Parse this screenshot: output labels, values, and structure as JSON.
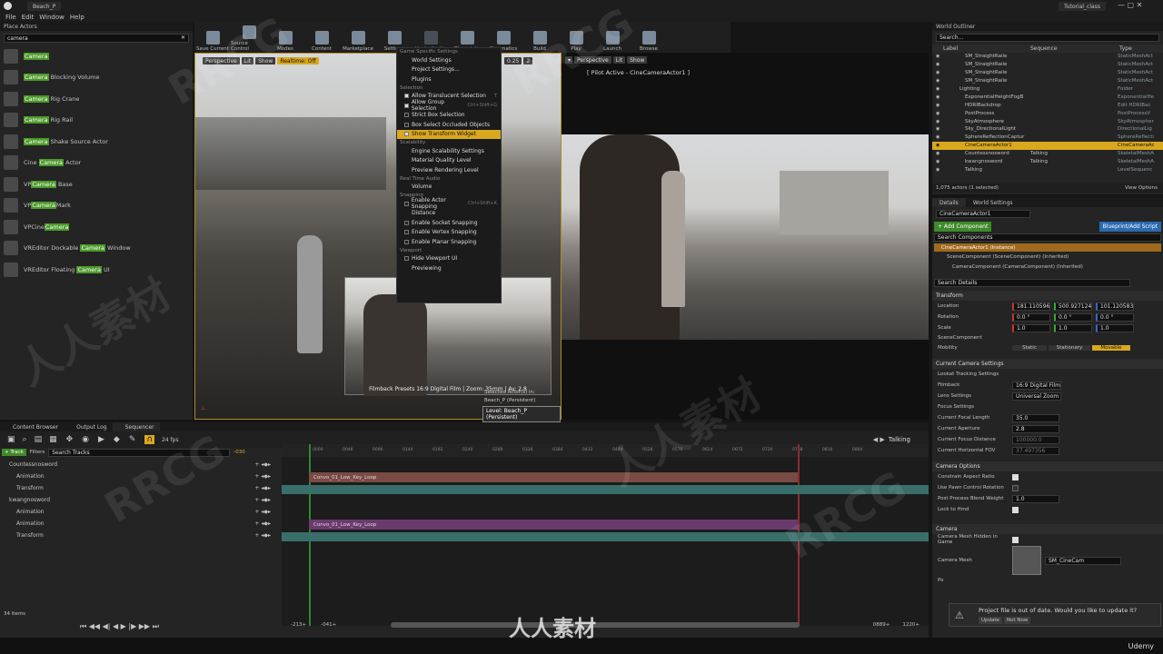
{
  "window": {
    "tab": "Beach_P",
    "project": "Tutorial_class"
  },
  "menu": [
    "File",
    "Edit",
    "Window",
    "Help"
  ],
  "place_actors": {
    "title": "Place Actors",
    "search": "camera",
    "items": [
      {
        "pre": "",
        "hl": "Camera",
        "post": ""
      },
      {
        "pre": "",
        "hl": "Camera",
        "post": " Blocking Volume"
      },
      {
        "pre": "",
        "hl": "Camera",
        "post": " Rig Crane"
      },
      {
        "pre": "",
        "hl": "Camera",
        "post": " Rig Rail"
      },
      {
        "pre": "",
        "hl": "Camera",
        "post": " Shake Source Actor"
      },
      {
        "pre": "Cine ",
        "hl": "Camera",
        "post": " Actor"
      },
      {
        "pre": "VP",
        "hl": "Camera",
        "post": " Base"
      },
      {
        "pre": "VP",
        "hl": "Camera",
        "post": "Mark"
      },
      {
        "pre": "VPCine",
        "hl": "Camera",
        "post": ""
      },
      {
        "pre": "VREditor Dockable ",
        "hl": "Camera",
        "post": " Window"
      },
      {
        "pre": "VREditor Floating ",
        "hl": "Camera",
        "post": " UI"
      }
    ]
  },
  "toolbar": [
    "Save Current",
    "Source Control",
    "Modes",
    "Content",
    "Marketplace",
    "Settings",
    "Media Profile",
    "Blueprints",
    "Cinematics",
    "Build",
    "Play",
    "Launch",
    "Browse"
  ],
  "viewport_left": {
    "perspective": "Perspective",
    "lit": "Lit",
    "show": "Show",
    "realtime": "Realtime: Off",
    "fov": "0.25",
    "num": "2",
    "film_info": "Filmback Presets 16:9 Digital Film | Zoom: 35mm | Av: 2.8",
    "selected": "Selected Actor(s) in:",
    "level_name": "Beach_P (Persistent)",
    "level_label": "Level:  Beach_P (Persistent)"
  },
  "settings_menu": {
    "sections": [
      {
        "title": "Game Specific Settings",
        "items": [
          {
            "label": "World Settings",
            "check": null,
            "sc": ""
          },
          {
            "label": "Project Settings...",
            "check": null,
            "sc": ""
          },
          {
            "label": "Plugins",
            "check": null,
            "sc": ""
          }
        ]
      },
      {
        "title": "Selection",
        "items": [
          {
            "label": "Allow Translucent Selection",
            "check": true,
            "sc": "T"
          },
          {
            "label": "Allow Group Selection",
            "check": true,
            "sc": "Ctrl+Shift+G"
          },
          {
            "label": "Strict Box Selection",
            "check": false,
            "sc": ""
          },
          {
            "label": "Box Select Occluded Objects",
            "check": false,
            "sc": ""
          },
          {
            "label": "Show Transform Widget",
            "check": true,
            "sc": ""
          }
        ]
      },
      {
        "title": "Scalability",
        "items": [
          {
            "label": "Engine Scalability Settings",
            "check": null,
            "sc": ""
          },
          {
            "label": "Material Quality Level",
            "check": null,
            "sc": ""
          },
          {
            "label": "Preview Rendering Level",
            "check": null,
            "sc": ""
          }
        ]
      },
      {
        "title": "Real Time Audio",
        "items": [
          {
            "label": "Volume",
            "check": null,
            "sc": ""
          }
        ]
      },
      {
        "title": "Snapping",
        "items": [
          {
            "label": "Enable Actor Snapping",
            "check": false,
            "sc": "Ctrl+Shift+K"
          },
          {
            "label": "Distance",
            "check": null,
            "sc": ""
          },
          {
            "label": "Enable Socket Snapping",
            "check": false,
            "sc": ""
          },
          {
            "label": "Enable Vertex Snapping",
            "check": false,
            "sc": ""
          },
          {
            "label": "Enable Planar Snapping",
            "check": false,
            "sc": ""
          }
        ]
      },
      {
        "title": "Viewport",
        "items": [
          {
            "label": "Hide Viewport UI",
            "check": false,
            "sc": ""
          },
          {
            "label": "Previewing",
            "check": null,
            "sc": ""
          }
        ]
      }
    ]
  },
  "viewport_right": {
    "perspective": "Perspective",
    "lit": "Lit",
    "show": "Show",
    "pilot": "[ Pilot Active - CineCameraActor1 ]"
  },
  "outliner": {
    "title": "World Outliner",
    "search": "Search...",
    "cols": [
      "Label",
      "Sequence",
      "Type"
    ],
    "rows": [
      {
        "label": "SM_StraightRaile",
        "seq": "",
        "type": "StaticMeshAct"
      },
      {
        "label": "SM_StraightRaile",
        "seq": "",
        "type": "StaticMeshAct"
      },
      {
        "label": "SM_StraightRaile",
        "seq": "",
        "type": "StaticMeshAct"
      },
      {
        "label": "SM_StraightRaile",
        "seq": "",
        "type": "StaticMeshAct"
      },
      {
        "label": "Lighting",
        "seq": "",
        "type": "Folder"
      },
      {
        "label": "ExponentialHeightFogB",
        "seq": "",
        "type": "ExponentialHe"
      },
      {
        "label": "HDRIBackdrop",
        "seq": "",
        "type": "Edit HDRIBac"
      },
      {
        "label": "PostProcess",
        "seq": "",
        "type": "PostProcessV"
      },
      {
        "label": "SkyAtmosphere",
        "seq": "",
        "type": "SkyAtmospher"
      },
      {
        "label": "Sky_DirectionalLight",
        "seq": "",
        "type": "DirectionalLig"
      },
      {
        "label": "SphereReflectionCaptur",
        "seq": "",
        "type": "SphereReflecti"
      },
      {
        "label": "CineCameraActor1",
        "seq": "",
        "type": "CineCameraAc"
      },
      {
        "label": "Countessnosword",
        "seq": "Talking",
        "type": "SkeletalMeshA"
      },
      {
        "label": "kwangnosword",
        "seq": "Talking",
        "type": "SkeletalMeshA"
      },
      {
        "label": "Talking",
        "seq": "",
        "type": "LevelSequenc"
      }
    ],
    "count": "1,075 actors (1 selected)",
    "view_options": "View Options"
  },
  "details": {
    "tab1": "Details",
    "tab2": "World Settings",
    "name": "CineCameraActor1",
    "add": "+ Add Component",
    "bp": "Blueprint/Add Script",
    "search_comp": "Search Components",
    "instance": "CineCameraActor1 (Instance)",
    "comp1": "SceneComponent (SceneComponent) (Inherited)",
    "comp2": "CameraComponent (CameraComponent) (Inherited)",
    "search_details": "Search Details",
    "transform": "Transform",
    "location": "Location",
    "loc": [
      "181.110596",
      "500.927124",
      "101.120583"
    ],
    "rotation": "Rotation",
    "rot": [
      "0.0 °",
      "0.0 °",
      "0.0 °"
    ],
    "scale": "Scale",
    "scl": [
      "1.0",
      "1.0",
      "1.0"
    ],
    "scene_comp": "SceneComponent",
    "mobility": "Mobility",
    "mob": [
      "Static",
      "Stationary",
      "Movable"
    ],
    "ccs": "Current Camera Settings",
    "lookat": "Lookat Tracking Settings",
    "filmback": "Filmback",
    "filmback_v": "16:9 Digital Film",
    "lens": "Lens Settings",
    "lens_v": "Universal Zoom",
    "focus": "Focus Settings",
    "cfl": "Current Focal Length",
    "cfl_v": "35.0",
    "ca": "Current Aperture",
    "ca_v": "2.8",
    "cfd": "Current Focus Distance",
    "cfd_v": "100000.0",
    "chf": "Current Horizontal FOV",
    "chf_v": "37.497356",
    "co": "Camera Options",
    "car": "Constrain Aspect Ratio",
    "upcr": "Use Pawn Control Rotation",
    "ppbw": "Post Process Blend Weight",
    "ppbw_v": "1.0",
    "lth": "Lock to Hmd",
    "cam": "Camera",
    "cmhig": "Camera Mesh Hidden in Game",
    "cmesh": "Camera Mesh",
    "cmesh_v": "SM_CineCam",
    "po": "Po"
  },
  "bottom_tabs": [
    "Content Browser",
    "Output Log",
    "Sequencer"
  ],
  "sequencer": {
    "track": "+ Track",
    "filters": "Filters",
    "search": "Search Tracks",
    "fps": "24 fps",
    "talking": "Talking",
    "start": "-030",
    "items": "34 items",
    "tracks": [
      {
        "label": "Countessnosword",
        "lvl": 0
      },
      {
        "label": "Animation",
        "lvl": 1
      },
      {
        "label": "Transform",
        "lvl": 1
      },
      {
        "label": "kwangnosword",
        "lvl": 0
      },
      {
        "label": "Animation",
        "lvl": 1
      },
      {
        "label": "Animation",
        "lvl": 1
      },
      {
        "label": "Transform",
        "lvl": 1
      }
    ],
    "clip1": "Convo_01_Low_Key_Loop",
    "clip2": "Convo_01_Low_Key_Loop",
    "ticks": [
      "0000",
      "0048",
      "0096",
      "0144",
      "0192",
      "0240",
      "0288",
      "0336",
      "0384",
      "0432",
      "0480",
      "0528",
      "0576",
      "0624",
      "0672",
      "0720",
      "0768",
      "0816",
      "0864"
    ],
    "bottom": [
      "-213+",
      "-041+",
      "0889+",
      "1220+"
    ]
  },
  "notify": {
    "text": "Project file is out of date. Would you like to update it?",
    "update": "Update",
    "not_now": "Not Now"
  },
  "udemy": "Udemy",
  "watermark": [
    "RRCG",
    "人人素材"
  ]
}
